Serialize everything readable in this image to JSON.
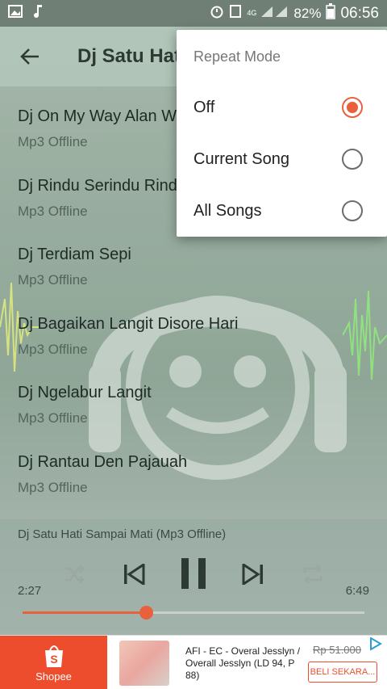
{
  "status_bar": {
    "network": "4G",
    "battery": "82%",
    "time": "06:56"
  },
  "app_bar": {
    "title": "Dj Satu Hati"
  },
  "songs": [
    {
      "title": "Dj On My Way Alan Walker",
      "subtitle": "Mp3 Offline"
    },
    {
      "title": "Dj Rindu Serindu Rindunya",
      "subtitle": "Mp3 Offline"
    },
    {
      "title": "Dj Terdiam Sepi",
      "subtitle": "Mp3 Offline"
    },
    {
      "title": "Dj Bagaikan Langit Disore Hari",
      "subtitle": "Mp3 Offline"
    },
    {
      "title": "Dj Ngelabur Langit",
      "subtitle": "Mp3 Offline"
    },
    {
      "title": "Dj Rantau Den Pajauah",
      "subtitle": "Mp3 Offline"
    }
  ],
  "player": {
    "now_playing": "Dj Satu Hati Sampai Mati (Mp3 Offline)",
    "elapsed": "2:27",
    "duration": "6:49",
    "progress_fraction": 0.36
  },
  "repeat_menu": {
    "title": "Repeat Mode",
    "options": [
      {
        "label": "Off",
        "selected": true
      },
      {
        "label": "Current Song",
        "selected": false
      },
      {
        "label": "All Songs",
        "selected": false
      }
    ]
  },
  "ad": {
    "brand": "Shopee",
    "text": "AFI - EC - Overal Jesslyn / Overall Jesslyn (LD 94, P 88)",
    "price": "Rp 51.000",
    "cta": "BELI SEKARA..."
  },
  "colors": {
    "accent": "#e8603c",
    "shopee": "#ee4d2d"
  }
}
